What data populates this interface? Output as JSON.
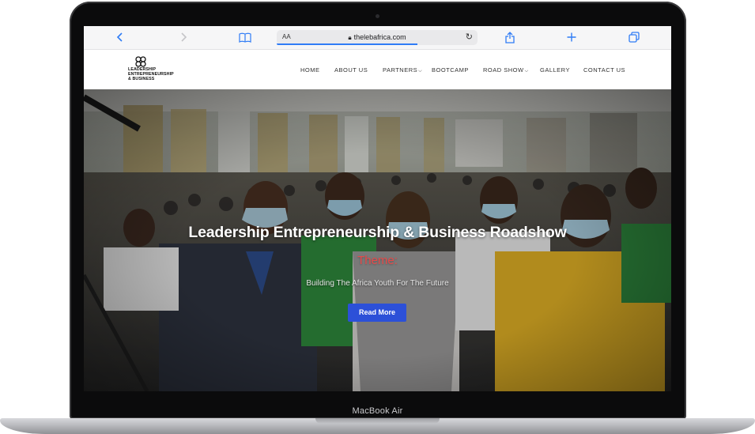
{
  "device": {
    "model_label": "MacBook Air"
  },
  "browser": {
    "text_size_label": "AA",
    "url": "thelebafrica.com",
    "icons": [
      "chevron-left-icon",
      "chevron-right-icon",
      "book-icon",
      "lock-icon",
      "reload-icon",
      "share-icon",
      "plus-icon",
      "tabs-icon"
    ]
  },
  "site": {
    "logo_text": "LEADERSHIP\nENTREPRENEURSHIP\n& BUSINESS",
    "nav": [
      {
        "label": "HOME"
      },
      {
        "label": "ABOUT US"
      },
      {
        "label": "PARTNERS",
        "dropdown": true
      },
      {
        "label": "BOOTCAMP"
      },
      {
        "label": "ROAD SHOW",
        "dropdown": true
      },
      {
        "label": "GALLERY"
      },
      {
        "label": "CONTACT US"
      }
    ],
    "nav_caret": "⌵",
    "hero": {
      "title": "Leadership Entrepreneurship & Business Roadshow",
      "theme_label": "Theme:",
      "subtitle": "Building The Africa Youth For The Future",
      "button_label": "Read More"
    }
  },
  "colors": {
    "accent_button": "#2c50d8",
    "theme_text": "#e74a4a",
    "safari_blue": "#2f7cf6"
  }
}
